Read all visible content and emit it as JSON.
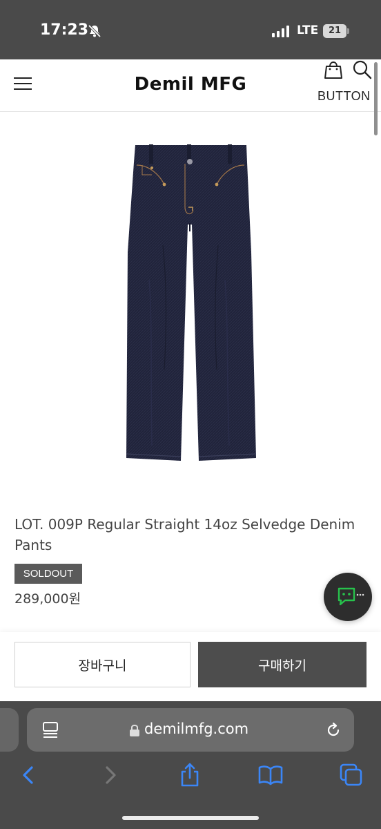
{
  "status_bar": {
    "time": "17:23",
    "network": "LTE",
    "battery": "21"
  },
  "header": {
    "brand": "Demil MFG",
    "button_label": "BUTTON"
  },
  "product": {
    "title": "LOT. 009P Regular Straight 14oz Selvedge Denim Pants",
    "badge": "SOLDOUT",
    "price": "289,000원"
  },
  "actions": {
    "cart_label": "장바구니",
    "buy_label": "구매하기"
  },
  "browser": {
    "url": "demilmfg.com"
  },
  "icons": {
    "menu": "hamburger-icon",
    "cart": "shopping-bag-icon",
    "search": "search-icon",
    "chat": "chat-icon",
    "tabs": "tab-overview-icon",
    "reload": "reload-icon",
    "back": "chevron-left-icon",
    "forward": "chevron-right-icon",
    "share": "share-icon",
    "bookmarks": "book-icon",
    "tabs_switcher": "tabs-icon"
  },
  "colors": {
    "chrome": "#4a4a4a",
    "button_dark": "#4d4d4d",
    "safari_link": "#3b86f7",
    "chat_green": "#27c24c"
  }
}
